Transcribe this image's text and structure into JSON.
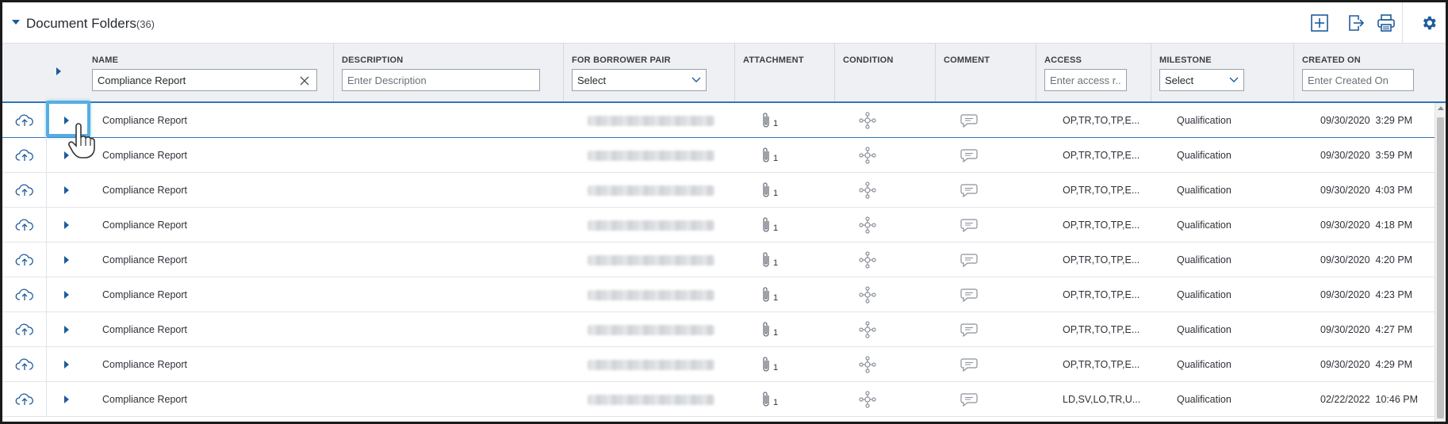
{
  "panel": {
    "title": "Document Folders",
    "count": "(36)"
  },
  "toolbar_icons": [
    "add-icon",
    "export-icon",
    "print-icon",
    "gear-icon"
  ],
  "columns": {
    "name": {
      "label": "NAME",
      "value": "Compliance Report"
    },
    "description": {
      "label": "DESCRIPTION",
      "placeholder": "Enter Description"
    },
    "borrower_pair": {
      "label": "FOR BORROWER PAIR",
      "selected": "Select"
    },
    "attachment": {
      "label": "ATTACHMENT"
    },
    "condition": {
      "label": "CONDITION"
    },
    "comment": {
      "label": "COMMENT"
    },
    "access": {
      "label": "ACCESS",
      "placeholder": "Enter access r..."
    },
    "milestone": {
      "label": "MILESTONE",
      "selected": "Select"
    },
    "created_on": {
      "label": "CREATED ON",
      "placeholder": "Enter Created On"
    }
  },
  "rows": [
    {
      "name": "Compliance Report",
      "attachments": "1",
      "access": "OP,TR,TO,TP,E...",
      "milestone": "Qualification",
      "date": "09/30/2020",
      "time": "3:29 PM"
    },
    {
      "name": "Compliance Report",
      "attachments": "1",
      "access": "OP,TR,TO,TP,E...",
      "milestone": "Qualification",
      "date": "09/30/2020",
      "time": "3:59 PM"
    },
    {
      "name": "Compliance Report",
      "attachments": "1",
      "access": "OP,TR,TO,TP,E...",
      "milestone": "Qualification",
      "date": "09/30/2020",
      "time": "4:03 PM"
    },
    {
      "name": "Compliance Report",
      "attachments": "1",
      "access": "OP,TR,TO,TP,E...",
      "milestone": "Qualification",
      "date": "09/30/2020",
      "time": "4:18 PM"
    },
    {
      "name": "Compliance Report",
      "attachments": "1",
      "access": "OP,TR,TO,TP,E...",
      "milestone": "Qualification",
      "date": "09/30/2020",
      "time": "4:20 PM"
    },
    {
      "name": "Compliance Report",
      "attachments": "1",
      "access": "OP,TR,TO,TP,E...",
      "milestone": "Qualification",
      "date": "09/30/2020",
      "time": "4:23 PM"
    },
    {
      "name": "Compliance Report",
      "attachments": "1",
      "access": "OP,TR,TO,TP,E...",
      "milestone": "Qualification",
      "date": "09/30/2020",
      "time": "4:27 PM"
    },
    {
      "name": "Compliance Report",
      "attachments": "1",
      "access": "OP,TR,TO,TP,E...",
      "milestone": "Qualification",
      "date": "09/30/2020",
      "time": "4:29 PM"
    },
    {
      "name": "Compliance Report",
      "attachments": "1",
      "access": "LD,SV,LO,TR,U...",
      "milestone": "Qualification",
      "date": "02/22/2022",
      "time": "10:46 PM"
    }
  ],
  "colors": {
    "accent": "#1e5b9a",
    "highlight": "#55aee3",
    "header_bg": "#eef0f3"
  }
}
